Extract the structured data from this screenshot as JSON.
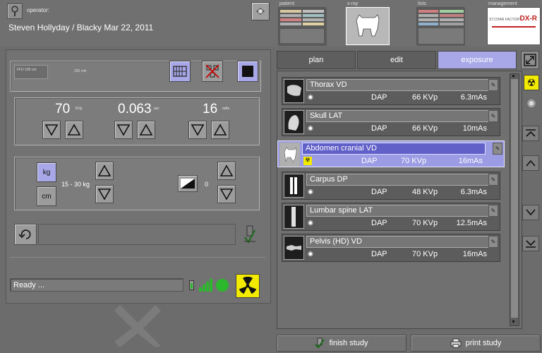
{
  "header": {
    "operator_label": "operator:",
    "operator_name": "Steven Hollyday / Blacky  Mar 22, 2011"
  },
  "nav_tabs": [
    {
      "label": "patient"
    },
    {
      "label": "x-ray"
    },
    {
      "label": "lists"
    },
    {
      "label": "management"
    }
  ],
  "brand": {
    "text": "DX-R",
    "prefix": "ST.CHAR FACTORY"
  },
  "generator": {
    "ffd": "FFD 100 cm",
    "ma": "250 mA",
    "kvp": {
      "value": "70",
      "unit": "KVp"
    },
    "sec": {
      "value": "0.063",
      "unit": "sec"
    },
    "mas": {
      "value": "16",
      "unit": "mAs"
    }
  },
  "patient_size": {
    "kg_label": "kg",
    "cm_label": "cm",
    "range": "15 - 30 kg",
    "density": "0"
  },
  "status": {
    "text": "Ready ..."
  },
  "mode_tabs": [
    {
      "label": "plan",
      "active": false
    },
    {
      "label": "edit",
      "active": false
    },
    {
      "label": "exposure",
      "active": true
    }
  ],
  "protocols": [
    {
      "name": "Thorax VD",
      "dap": "DAP",
      "kvp": "66 KVp",
      "mas": "6.3mAs"
    },
    {
      "name": "Skull LAT",
      "dap": "DAP",
      "kvp": "66 KVp",
      "mas": "10mAs"
    },
    {
      "name": "Abdomen cranial VD",
      "dap": "DAP",
      "kvp": "70 KVp",
      "mas": "16mAs",
      "selected": true
    },
    {
      "name": "Carpus DP",
      "dap": "DAP",
      "kvp": "48 KVp",
      "mas": "6.3mAs"
    },
    {
      "name": "Lumbar spine LAT",
      "dap": "DAP",
      "kvp": "70 KVp",
      "mas": "12.5mAs"
    },
    {
      "name": "Pelvis (HD) VD",
      "dap": "DAP",
      "kvp": "70 KVp",
      "mas": "16mAs"
    }
  ],
  "actions": {
    "finish_study": "finish study",
    "print_study": "print study"
  },
  "colors": {
    "accent": "#a8a8e8",
    "selected": "#9c9ce4",
    "radiation": "#f2ea00"
  }
}
